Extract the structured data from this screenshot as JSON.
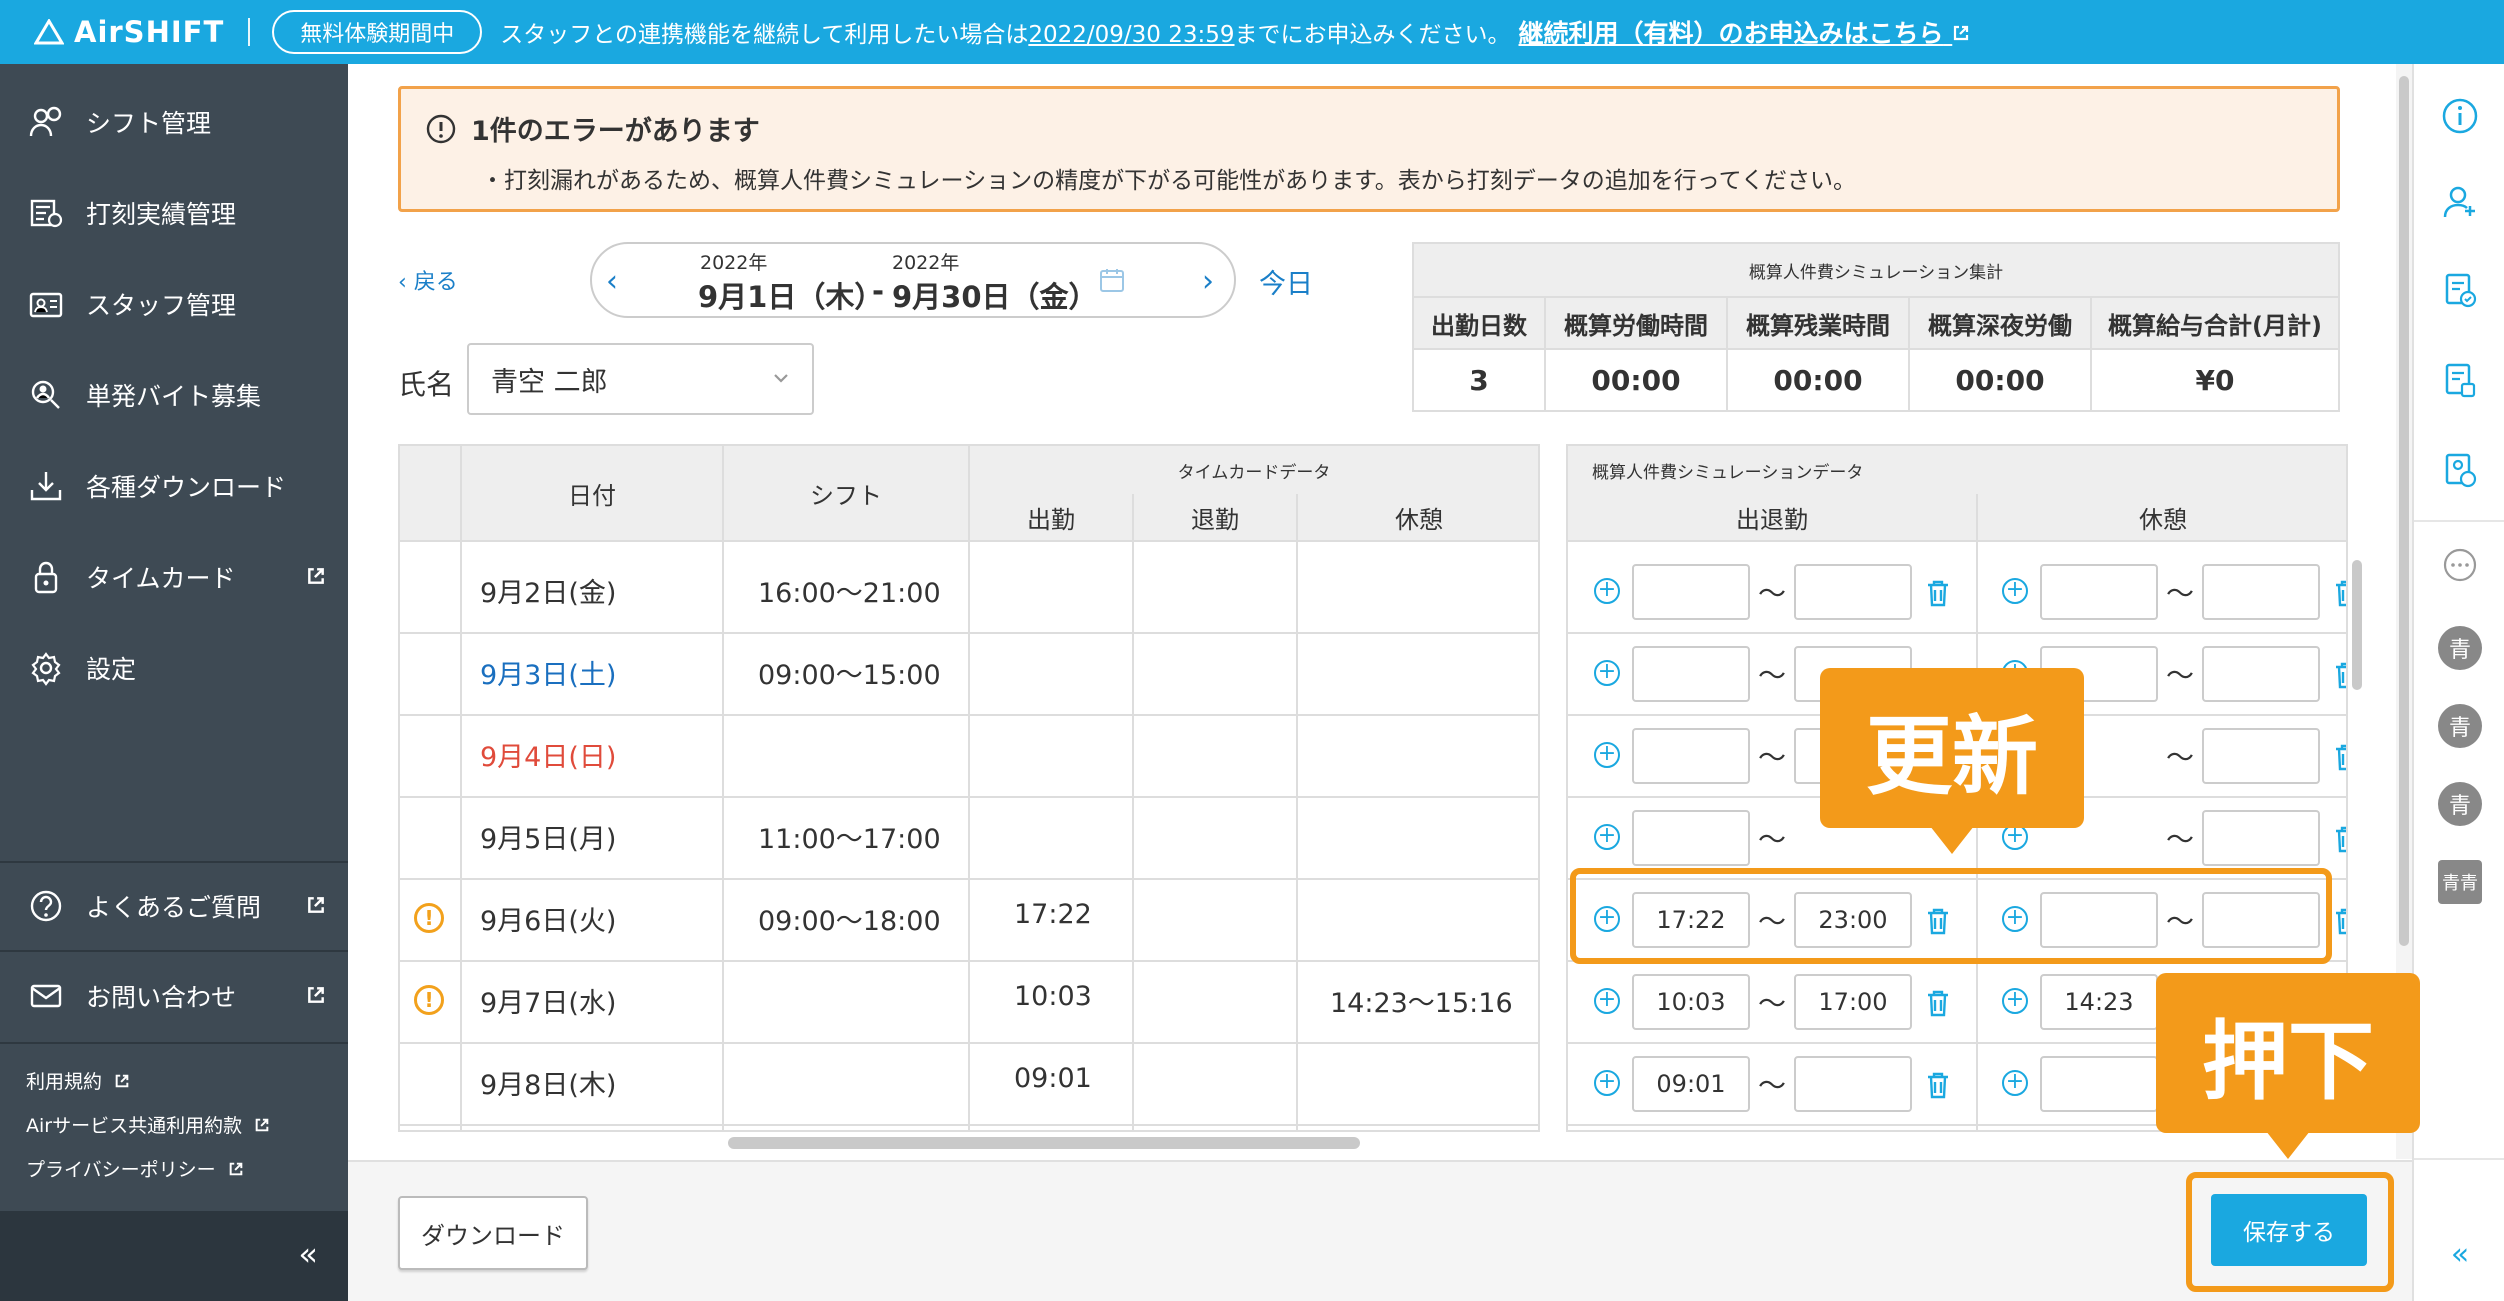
{
  "header": {
    "logo": "AirSHIFT",
    "trial_badge": "無料体験期間中",
    "notice_pre": "スタッフとの連携機能を継続して利用したい場合は",
    "notice_deadline": "2022/09/30 23:59",
    "notice_post": "までにお申込みください。",
    "notice_link": "継続利用（有料）のお申込みはこちら"
  },
  "sidebar": {
    "items": [
      {
        "label": "シフト管理",
        "icon": "shift-icon"
      },
      {
        "label": "打刻実績管理",
        "icon": "timecard-list-icon"
      },
      {
        "label": "スタッフ管理",
        "icon": "staff-icon"
      },
      {
        "label": "単発バイト募集",
        "icon": "recruit-icon"
      },
      {
        "label": "各種ダウンロード",
        "icon": "download-icon"
      },
      {
        "label": "タイムカード",
        "icon": "lock-icon"
      },
      {
        "label": "設定",
        "icon": "gear-icon"
      }
    ],
    "help": [
      {
        "label": "よくあるご質問",
        "icon": "question-icon"
      },
      {
        "label": "お問い合わせ",
        "icon": "mail-icon"
      }
    ],
    "links": [
      "利用規約",
      "Airサービス共通利用約款",
      "プライバシーポリシー"
    ],
    "collapse": "«"
  },
  "error": {
    "title": "1件のエラーがあります",
    "message": "・打刻漏れがあるため、概算人件費シミュレーションの精度が下がる可能性があります。表から打刻データの追加を行ってください。"
  },
  "nav": {
    "back": "戻る",
    "start_year": "2022年",
    "start_date": "9月1日（木）",
    "sep": "-",
    "end_year": "2022年",
    "end_date": "9月30日（金）",
    "today": "今日"
  },
  "name": {
    "label": "氏名",
    "value": "青空 二郎"
  },
  "summary": {
    "title": "概算人件費シミュレーション集計",
    "columns": [
      "出勤日数",
      "概算労働時間",
      "概算残業時間",
      "概算深夜労働",
      "概算給与合計(月計)"
    ],
    "values": [
      "3",
      "00:00",
      "00:00",
      "00:00",
      "¥0"
    ]
  },
  "table": {
    "headers": {
      "date": "日付",
      "shift": "シフト",
      "timecard": "タイムカードデータ",
      "in": "出勤",
      "out": "退勤",
      "break": "休憩",
      "sim": "概算人件費シミュレーションデータ",
      "sim_inout": "出退勤",
      "sim_break": "休憩"
    },
    "rows": [
      {
        "date": "9月2日(金)",
        "color": "normal",
        "shift": "16:00〜21:00",
        "in": "",
        "out": "",
        "break": "",
        "sim_in": "",
        "sim_out": "",
        "sim_break_in": "",
        "sim_break_out": "",
        "warn": false
      },
      {
        "date": "9月3日(土)",
        "color": "blue",
        "shift": "09:00〜15:00",
        "in": "",
        "out": "",
        "break": "",
        "sim_in": "",
        "sim_out": "",
        "sim_break_in": "",
        "sim_break_out": "",
        "warn": false
      },
      {
        "date": "9月4日(日)",
        "color": "red",
        "shift": "",
        "in": "",
        "out": "",
        "break": "",
        "sim_in": "",
        "sim_out": "",
        "sim_break_in": "",
        "sim_break_out": "",
        "warn": false
      },
      {
        "date": "9月5日(月)",
        "color": "normal",
        "shift": "11:00〜17:00",
        "in": "",
        "out": "",
        "break": "",
        "sim_in": "",
        "sim_out": "",
        "sim_break_in": "",
        "sim_break_out": "",
        "warn": false
      },
      {
        "date": "9月6日(火)",
        "color": "normal",
        "shift": "09:00〜18:00",
        "in": "17:22",
        "out": "",
        "break": "",
        "sim_in": "17:22",
        "sim_out": "23:00",
        "sim_break_in": "",
        "sim_break_out": "",
        "warn": true
      },
      {
        "date": "9月7日(水)",
        "color": "normal",
        "shift": "",
        "in": "10:03",
        "out": "",
        "break": "14:23〜15:16",
        "sim_in": "10:03",
        "sim_out": "17:00",
        "sim_break_in": "14:23",
        "sim_break_out": "",
        "warn": true
      },
      {
        "date": "9月8日(木)",
        "color": "normal",
        "shift": "",
        "in": "09:01",
        "out": "",
        "break": "",
        "sim_in": "09:01",
        "sim_out": "",
        "sim_break_in": "",
        "sim_break_out": "",
        "warn": false
      }
    ],
    "tilde": "〜"
  },
  "footer": {
    "download": "ダウンロード",
    "save": "保存する"
  },
  "annotations": {
    "update": "更新",
    "press": "押下"
  },
  "rightbar": {
    "avatars": [
      "青",
      "青",
      "青",
      "青青"
    ]
  },
  "colors": {
    "brand": "#1aa8e0",
    "annotation": "#f39a1a",
    "sidebar": "#3e4a54",
    "warning": "#f2a11c"
  }
}
